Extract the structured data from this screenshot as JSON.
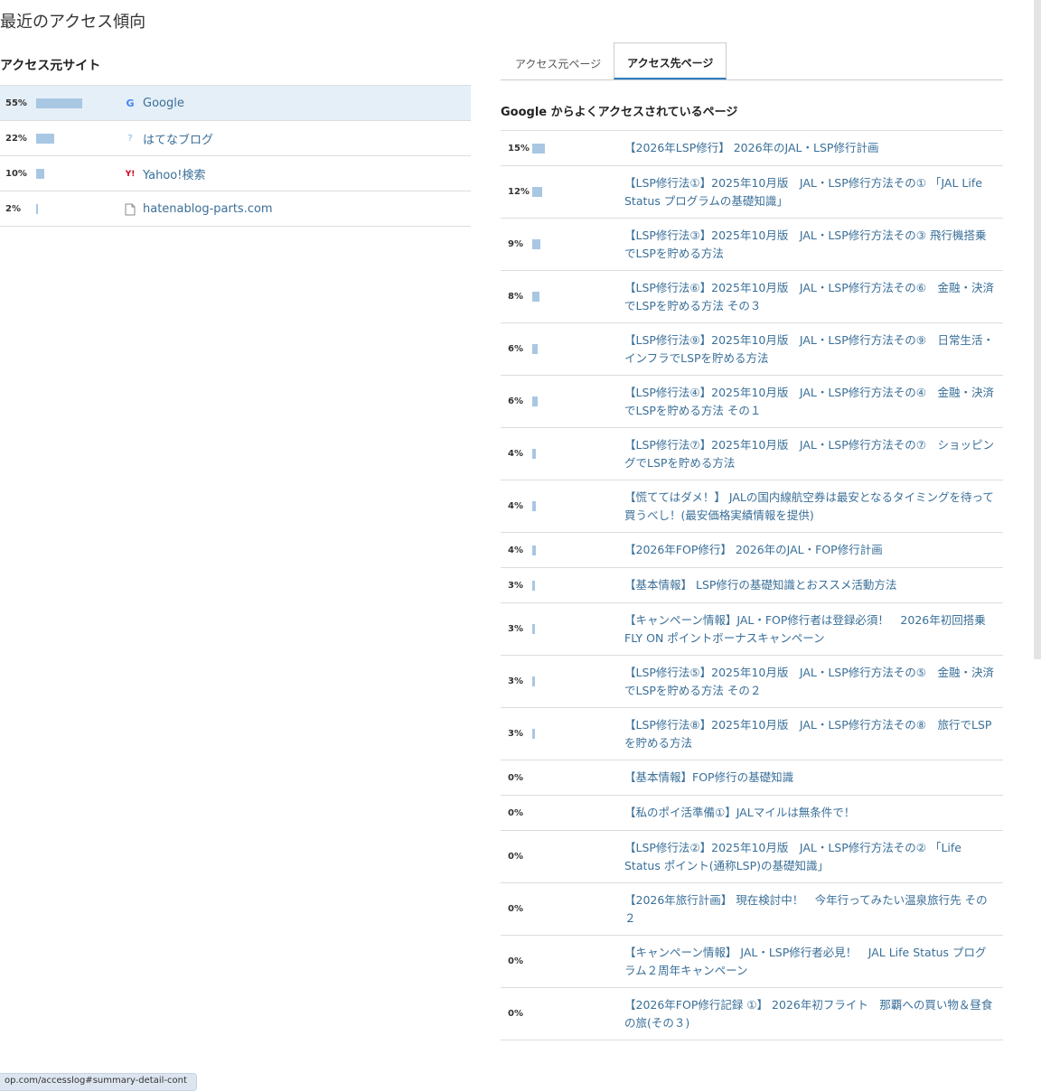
{
  "heading": "最近のアクセス傾向",
  "sources": {
    "title": "アクセス元サイト",
    "items": [
      {
        "pct": "55%",
        "value": 55,
        "name": "Google",
        "icon": "google-icon"
      },
      {
        "pct": "22%",
        "value": 22,
        "name": "はてなブログ",
        "icon": "hatena-icon"
      },
      {
        "pct": "10%",
        "value": 10,
        "name": "Yahoo!検索",
        "icon": "yahoo-icon"
      },
      {
        "pct": "2%",
        "value": 2,
        "name": "hatenablog-parts.com",
        "icon": "document-icon"
      }
    ]
  },
  "tabs": [
    "アクセス元ページ",
    "アクセス先ページ"
  ],
  "pages_title": "Google からよくアクセスされているページ",
  "pages": [
    {
      "pct": "15%",
      "value": 15,
      "text": "【2026年LSP修行】 2026年のJAL・LSP修行計画"
    },
    {
      "pct": "12%",
      "value": 12,
      "text": "【LSP修行法①】2025年10月版　JAL・LSP修行方法その① 「JAL Life Status プログラムの基礎知識」"
    },
    {
      "pct": "9%",
      "value": 9,
      "text": "【LSP修行法③】2025年10月版　JAL・LSP修行方法その③ 飛行機搭乗でLSPを貯める方法"
    },
    {
      "pct": "8%",
      "value": 8,
      "text": "【LSP修行法⑥】2025年10月版　JAL・LSP修行方法その⑥　金融・決済でLSPを貯める方法 その３"
    },
    {
      "pct": "6%",
      "value": 6,
      "text": "【LSP修行法⑨】2025年10月版　JAL・LSP修行方法その⑨　日常生活・インフラでLSPを貯める方法"
    },
    {
      "pct": "6%",
      "value": 6,
      "text": "【LSP修行法④】2025年10月版　JAL・LSP修行方法その④　金融・決済でLSPを貯める方法 その１"
    },
    {
      "pct": "4%",
      "value": 4,
      "text": "【LSP修行法⑦】2025年10月版　JAL・LSP修行方法その⑦　ショッピングでLSPを貯める方法"
    },
    {
      "pct": "4%",
      "value": 4,
      "text": "【慌ててはダメ！】 JALの国内線航空券は最安となるタイミングを待って買うべし！(最安価格実績情報を提供)"
    },
    {
      "pct": "4%",
      "value": 4,
      "text": "【2026年FOP修行】 2026年のJAL・FOP修行計画"
    },
    {
      "pct": "3%",
      "value": 3,
      "text": "【基本情報】 LSP修行の基礎知識とおススメ活動方法"
    },
    {
      "pct": "3%",
      "value": 3,
      "text": "【キャンペーン情報】JAL・FOP修行者は登録必須！　2026年初回搭乗FLY ON ポイントボーナスキャンペーン"
    },
    {
      "pct": "3%",
      "value": 3,
      "text": "【LSP修行法⑤】2025年10月版　JAL・LSP修行方法その⑤　金融・決済でLSPを貯める方法 その２"
    },
    {
      "pct": "3%",
      "value": 3,
      "text": "【LSP修行法⑧】2025年10月版　JAL・LSP修行方法その⑧　旅行でLSPを貯める方法"
    },
    {
      "pct": "0%",
      "value": 0,
      "text": "【基本情報】FOP修行の基礎知識"
    },
    {
      "pct": "0%",
      "value": 0,
      "text": "【私のポイ活準備①】JALマイルは無条件で！"
    },
    {
      "pct": "0%",
      "value": 0,
      "text": "【LSP修行法②】2025年10月版　JAL・LSP修行方法その② 「Life Status ポイント(通称LSP)の基礎知識」"
    },
    {
      "pct": "0%",
      "value": 0,
      "text": "【2026年旅行計画】 現在検討中！　今年行ってみたい温泉旅行先 その２"
    },
    {
      "pct": "0%",
      "value": 0,
      "text": "【キャンペーン情報】 JAL・LSP修行者必見！　JAL Life Status プログラム２周年キャンペーン"
    },
    {
      "pct": "0%",
      "value": 0,
      "text": "【2026年FOP修行記録 ①】 2026年初フライト　那覇への買い物＆昼食の旅(その３)"
    }
  ],
  "status_url": "op.com/accesslog#summary-detail-cont"
}
